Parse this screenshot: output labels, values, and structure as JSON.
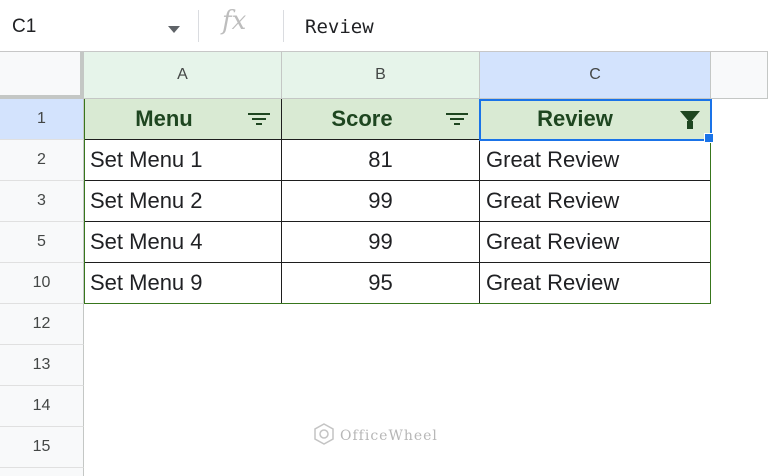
{
  "formula_bar": {
    "name_box": "C1",
    "fx": "fx",
    "value": "Review"
  },
  "columns": [
    {
      "id": "A",
      "label": "A"
    },
    {
      "id": "B",
      "label": "B"
    },
    {
      "id": "C",
      "label": "C"
    }
  ],
  "rows": [
    {
      "number": "1"
    },
    {
      "number": "2"
    },
    {
      "number": "3"
    },
    {
      "number": "5"
    },
    {
      "number": "10"
    },
    {
      "number": "12"
    },
    {
      "number": "13"
    },
    {
      "number": "14"
    },
    {
      "number": "15"
    }
  ],
  "table": {
    "headers": [
      "Menu",
      "Score",
      "Review"
    ],
    "data": [
      [
        "Set Menu 1",
        "81",
        "Great Review"
      ],
      [
        "Set Menu 2",
        "99",
        "Great Review"
      ],
      [
        "Set Menu 4",
        "99",
        "Great Review"
      ],
      [
        "Set Menu 9",
        "95",
        "Great Review"
      ]
    ]
  },
  "watermark": "OfficeWheel",
  "colors": {
    "header_fill": "#d9ead3",
    "header_text": "#1e4620",
    "selection": "#1a73e8"
  }
}
